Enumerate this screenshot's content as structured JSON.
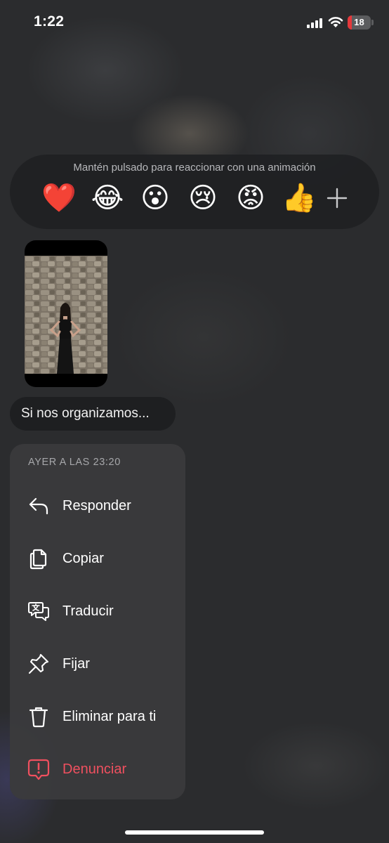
{
  "status_bar": {
    "time": "1:22",
    "battery_level": "18",
    "battery_fraction": 0.18,
    "battery_color": "#e5383b"
  },
  "reactions": {
    "hint": "Mantén pulsado para reaccionar con una animación",
    "emojis": [
      {
        "name": "red-heart",
        "glyph": "❤️"
      },
      {
        "name": "face-with-tears-of-joy",
        "glyph": "😂"
      },
      {
        "name": "astonished-face",
        "glyph": "😮"
      },
      {
        "name": "crying-face",
        "glyph": "😢"
      },
      {
        "name": "angry-face",
        "glyph": "😡"
      },
      {
        "name": "thumbs-up",
        "glyph": "👍"
      }
    ],
    "more_icon": "plus-icon"
  },
  "message": {
    "media_icon": "photo-thumbnail",
    "text": "Si nos organizamos..."
  },
  "context_menu": {
    "timestamp": "AYER A LAS 23:20",
    "items": [
      {
        "label": "Responder",
        "icon": "reply-icon"
      },
      {
        "label": "Copiar",
        "icon": "copy-icon"
      },
      {
        "label": "Traducir",
        "icon": "translate-icon"
      },
      {
        "label": "Fijar",
        "icon": "pin-icon"
      },
      {
        "label": "Eliminar para ti",
        "icon": "trash-icon"
      },
      {
        "label": "Denunciar",
        "icon": "report-icon",
        "color": "#f0505f"
      }
    ]
  }
}
